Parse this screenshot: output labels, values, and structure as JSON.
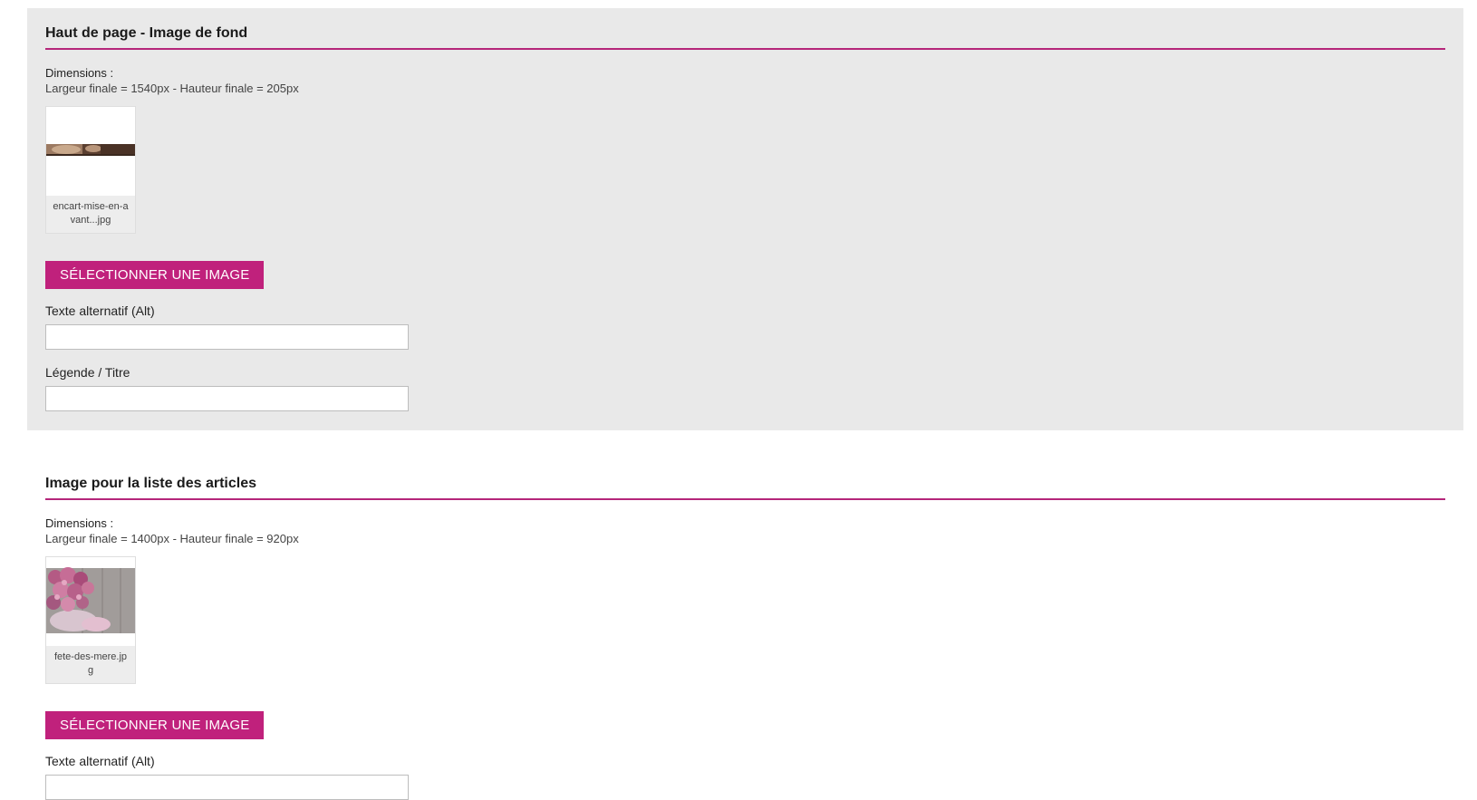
{
  "sections": [
    {
      "title": "Haut de page - Image de fond",
      "dimensions_label": "Dimensions :",
      "dimensions_value": "Largeur finale = 1540px - Hauteur finale = 205px",
      "thumbnail": {
        "caption": "encart-mise-en-avant...jpg",
        "image": "banner-strip-image"
      },
      "button_label": "SÉLECTIONNER UNE IMAGE",
      "alt_label": "Texte alternatif (Alt)",
      "alt_value": "",
      "legend_label": "Légende / Titre",
      "legend_value": ""
    },
    {
      "title": "Image pour la liste des articles",
      "dimensions_label": "Dimensions :",
      "dimensions_value": "Largeur finale = 1400px - Hauteur finale = 920px",
      "thumbnail": {
        "caption": "fete-des-mere.jpg",
        "image": "pink-roses-on-wood-image"
      },
      "button_label": "SÉLECTIONNER UNE IMAGE",
      "alt_label": "Texte alternatif (Alt)",
      "alt_value": ""
    }
  ],
  "colors": {
    "accent": "#c0217c",
    "panel_grey": "#e9e9e9",
    "divider": "#b5267a"
  }
}
